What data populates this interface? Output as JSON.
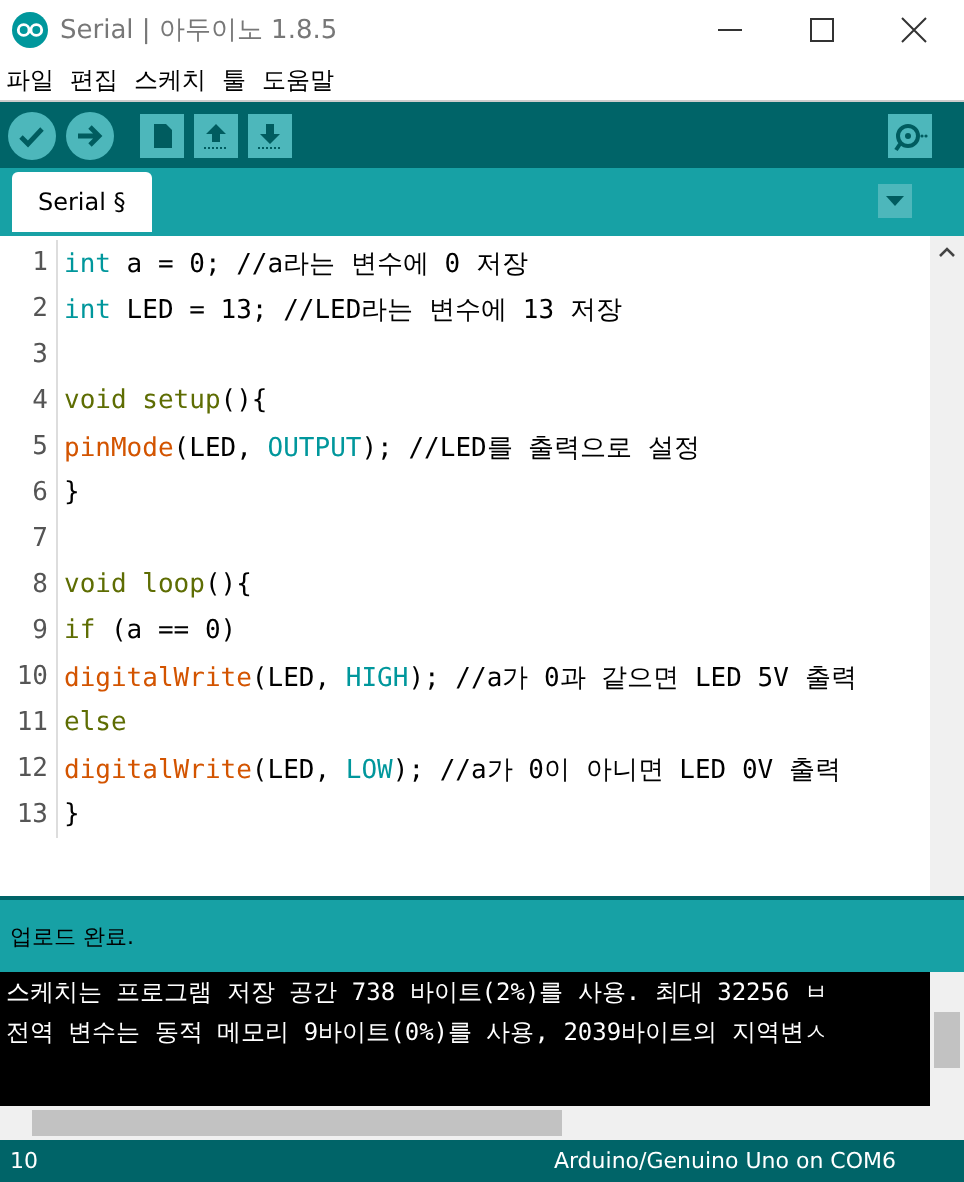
{
  "window": {
    "title": "Serial | 아두이노 1.8.5"
  },
  "menu": [
    "파일",
    "편집",
    "스케치",
    "툴",
    "도움말"
  ],
  "tabs": [
    {
      "label": "Serial §",
      "selected": true
    }
  ],
  "editor": {
    "lines": [
      {
        "number": "1",
        "tokens": [
          {
            "text": "int",
            "kind": "type"
          },
          {
            "text": " a = 0; //a라는 변수에 0 저장",
            "kind": "plain"
          }
        ]
      },
      {
        "number": "2",
        "tokens": [
          {
            "text": "int",
            "kind": "type"
          },
          {
            "text": " LED = 13; //LED라는 변수에 13 저장",
            "kind": "plain"
          }
        ]
      },
      {
        "number": "3"
      },
      {
        "number": "4",
        "tokens": [
          {
            "text": "void setup",
            "kind": "keyword"
          },
          {
            "text": "(){",
            "kind": "plain"
          }
        ]
      },
      {
        "number": "5",
        "tokens": [
          {
            "text": "pinMode",
            "kind": "function"
          },
          {
            "text": "(LED, ",
            "kind": "plain"
          },
          {
            "text": "OUTPUT",
            "kind": "constant"
          },
          {
            "text": "); //LED를 출력으로 설정",
            "kind": "plain"
          }
        ]
      },
      {
        "number": "6",
        "tokens": [
          {
            "text": "}",
            "kind": "plain"
          }
        ]
      },
      {
        "number": "7"
      },
      {
        "number": "8",
        "tokens": [
          {
            "text": "void loop",
            "kind": "keyword"
          },
          {
            "text": "(){",
            "kind": "plain"
          }
        ]
      },
      {
        "number": "9",
        "tokens": [
          {
            "text": "if",
            "kind": "keyword"
          },
          {
            "text": " (a == 0)",
            "kind": "plain"
          }
        ]
      },
      {
        "number": "10",
        "tokens": [
          {
            "text": "digitalWrite",
            "kind": "function"
          },
          {
            "text": "(LED, ",
            "kind": "plain"
          },
          {
            "text": "HIGH",
            "kind": "constant"
          },
          {
            "text": "); //a가 0과 같으면 LED 5V 출력",
            "kind": "plain"
          }
        ]
      },
      {
        "number": "11",
        "tokens": [
          {
            "text": "else",
            "kind": "keyword"
          }
        ]
      },
      {
        "number": "12",
        "tokens": [
          {
            "text": "digitalWrite",
            "kind": "function"
          },
          {
            "text": "(LED, ",
            "kind": "plain"
          },
          {
            "text": "LOW",
            "kind": "constant"
          },
          {
            "text": "); //a가 0이 아니면 LED 0V 출력",
            "kind": "plain"
          }
        ]
      },
      {
        "number": "13",
        "tokens": [
          {
            "text": "}",
            "kind": "plain"
          }
        ]
      }
    ]
  },
  "status": "업로드 완료.",
  "console": [
    "스케치는 프로그램 저장 공간 738 바이트(2%)를 사용. 최대 32256 ㅂ",
    "전역 변수는 동적 메모리 9바이트(0%)를 사용, 2039바이트의 지역변ㅅ"
  ],
  "status_bar": {
    "line": "10",
    "board": "Arduino/Genuino Uno on COM6"
  }
}
